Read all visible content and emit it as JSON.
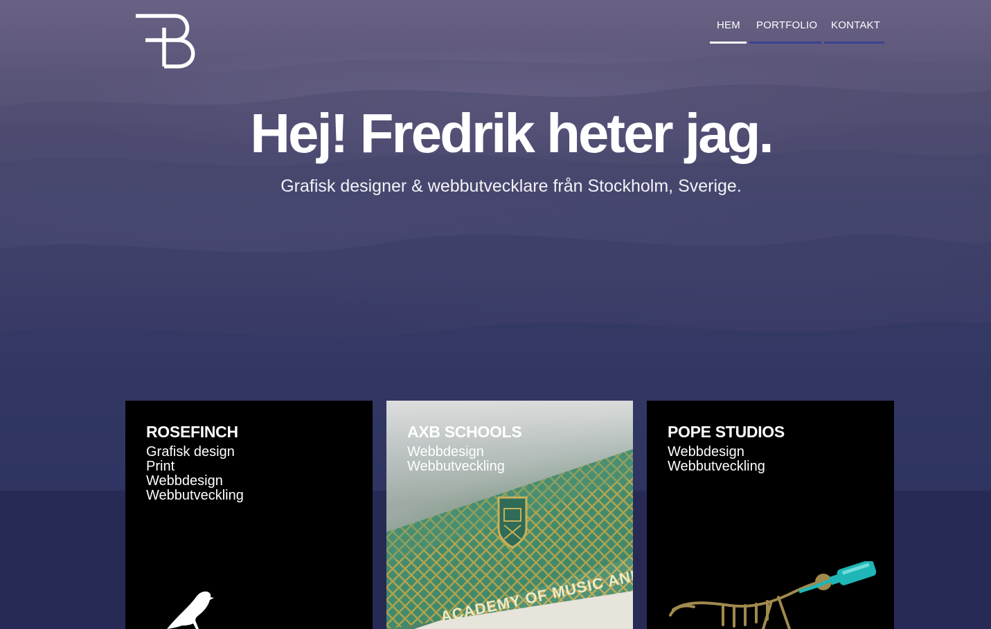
{
  "nav": {
    "items": [
      {
        "label": "HEM",
        "active": true
      },
      {
        "label": "PORTFOLIO",
        "active": false
      },
      {
        "label": "KONTAKT",
        "active": false
      }
    ],
    "underline_color": "#3c4290",
    "active_underline_color": "#ffffff"
  },
  "hero": {
    "title": "Hej! Fredrik heter jag.",
    "subtitle": "Grafisk designer & webbutvecklare från Stockholm, Sverige."
  },
  "cards": [
    {
      "title": "ROSEFINCH",
      "tags": [
        "Grafisk design",
        "Print",
        "Webbdesign",
        "Webbutveckling"
      ],
      "art": "bird-icon"
    },
    {
      "title": "AXB SCHOOLS",
      "tags": [
        "Webbdesign",
        "Webbutveckling"
      ],
      "art": "academy-sign-photo",
      "sign_text": "ACADEMY OF MUSIC AND BUSINESS"
    },
    {
      "title": "POPE STUDIOS",
      "tags": [
        "Webbdesign",
        "Webbutveckling"
      ],
      "art": "skeleton-bottle-illustration"
    }
  ],
  "colors": {
    "page_background": "#28284e",
    "card_background": "#000000"
  }
}
